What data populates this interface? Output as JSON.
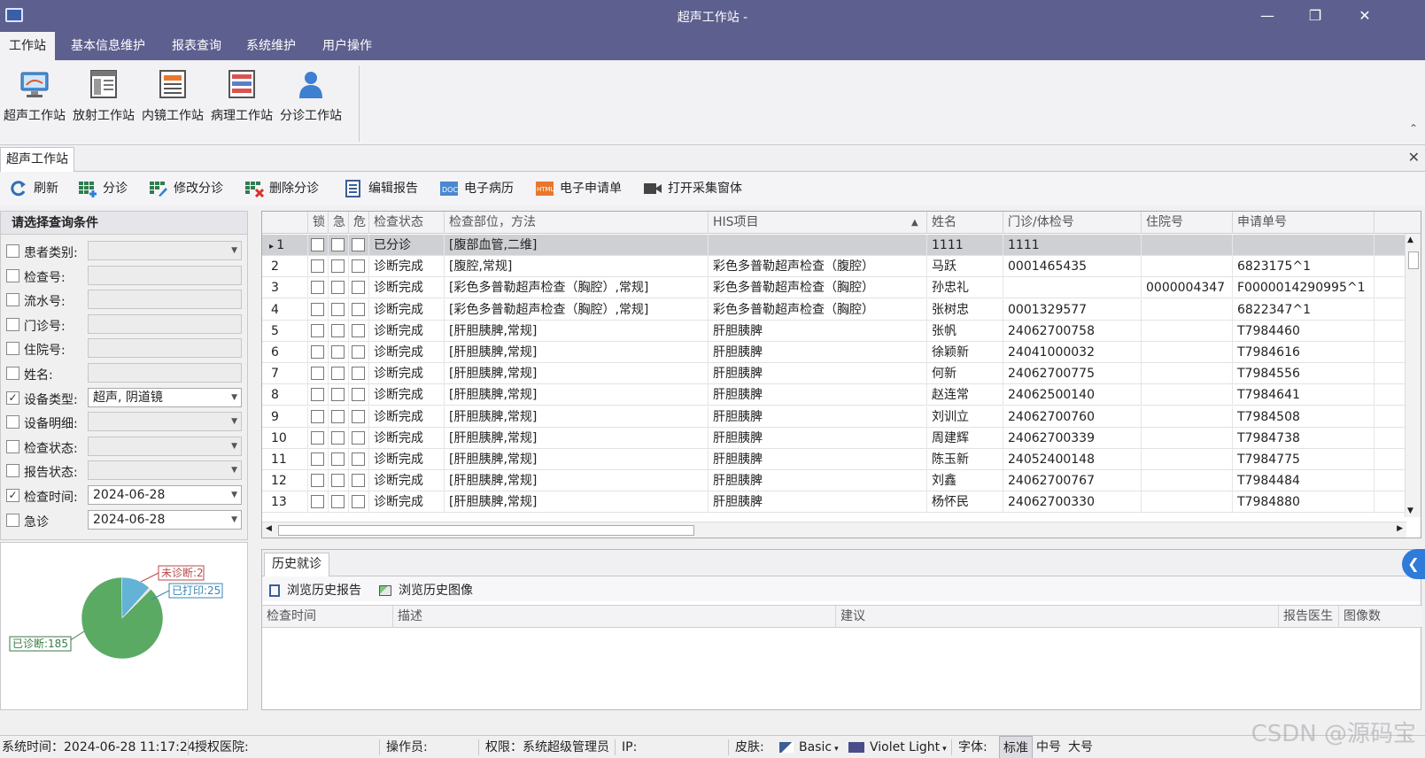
{
  "window": {
    "title": "超声工作站 -",
    "controls": [
      "—",
      "❐",
      "✕"
    ]
  },
  "menu": [
    {
      "label": "工作站",
      "active": true
    },
    {
      "label": "基本信息维护"
    },
    {
      "label": "报表查询"
    },
    {
      "label": "系统维护"
    },
    {
      "label": "用户操作"
    }
  ],
  "ribbon": {
    "buttons": [
      {
        "label": "超声工作站",
        "icon": "ultrasound-monitor-icon"
      },
      {
        "label": "放射工作站",
        "icon": "radiology-panel-icon"
      },
      {
        "label": "内镜工作站",
        "icon": "endoscope-panel-icon"
      },
      {
        "label": "病理工作站",
        "icon": "pathology-panel-icon"
      },
      {
        "label": "分诊工作站",
        "icon": "person-icon"
      }
    ],
    "collapse": "⌃"
  },
  "doc_tab": {
    "label": "超声工作站",
    "close": "✕"
  },
  "toolbar": [
    {
      "label": "刷新",
      "icon": "refresh-icon"
    },
    {
      "label": "分诊",
      "icon": "grid-add-icon"
    },
    {
      "label": "修改分诊",
      "icon": "grid-edit-icon"
    },
    {
      "label": "删除分诊",
      "icon": "grid-delete-icon"
    },
    {
      "label": "编辑报告",
      "icon": "document-icon"
    },
    {
      "label": "电子病历",
      "icon": "doc-file-icon"
    },
    {
      "label": "电子申请单",
      "icon": "html-file-icon"
    },
    {
      "label": "打开采集窗体",
      "icon": "video-camera-icon"
    }
  ],
  "query": {
    "title": "请选择查询条件",
    "fields": [
      {
        "label": "患者类别:",
        "checked": false,
        "value": "",
        "dropdown": true,
        "filled": false
      },
      {
        "label": "检查号:",
        "checked": false,
        "value": "",
        "dropdown": false,
        "filled": false
      },
      {
        "label": "流水号:",
        "checked": false,
        "value": "",
        "dropdown": false,
        "filled": false
      },
      {
        "label": "门诊号:",
        "checked": false,
        "value": "",
        "dropdown": false,
        "filled": false
      },
      {
        "label": "住院号:",
        "checked": false,
        "value": "",
        "dropdown": false,
        "filled": false
      },
      {
        "label": "姓名:",
        "checked": false,
        "value": "",
        "dropdown": false,
        "filled": false
      },
      {
        "label": "设备类型:",
        "checked": true,
        "value": "超声, 阴道镜",
        "dropdown": true,
        "filled": true
      },
      {
        "label": "设备明细:",
        "checked": false,
        "value": "",
        "dropdown": true,
        "filled": false
      },
      {
        "label": "检查状态:",
        "checked": false,
        "value": "",
        "dropdown": true,
        "filled": false
      },
      {
        "label": "报告状态:",
        "checked": false,
        "value": "",
        "dropdown": true,
        "filled": false
      },
      {
        "label": "检查时间:",
        "checked": true,
        "value": "2024-06-28",
        "dropdown": true,
        "filled": true
      },
      {
        "label": "急诊",
        "checked": false,
        "value": "2024-06-28",
        "dropdown": true,
        "filled": true
      }
    ]
  },
  "chart_data": {
    "type": "pie",
    "slices": [
      {
        "label": "已诊断:185",
        "value": 185,
        "color": "#5aaa64"
      },
      {
        "label": "已打印:25",
        "value": 25,
        "color": "#62b3d6"
      },
      {
        "label": "未诊断:2",
        "value": 2,
        "color": "#e8e0dc"
      }
    ],
    "label_colors": {
      "已诊断:185": "#3a7a45",
      "已打印:25": "#3a86b3",
      "未诊断:2": "#b84a4a"
    }
  },
  "grid": {
    "columns": [
      "",
      "锁",
      "急",
      "危",
      "检查状态",
      "检查部位，方法",
      "HIS项目",
      "姓名",
      "门诊/体检号",
      "住院号",
      "申请单号"
    ],
    "sort_indicator": "▲",
    "rows": [
      {
        "no": "1",
        "status": "已分诊",
        "part": "[腹部血管,二维]",
        "his": "",
        "name": "1111",
        "mz": "1111",
        "zy": "",
        "apply": "",
        "selected": true
      },
      {
        "no": "2",
        "status": "诊断完成",
        "part": "[腹腔,常规]",
        "his": "彩色多普勒超声检查（腹腔）",
        "name": "马跃",
        "mz": "0001465435",
        "zy": "",
        "apply": "6823175^1"
      },
      {
        "no": "3",
        "status": "诊断完成",
        "part": "[彩色多普勒超声检查（胸腔）,常规]",
        "his": "彩色多普勒超声检查（胸腔）",
        "name": "孙忠礼",
        "mz": "",
        "zy": "0000004347",
        "apply": "F0000014290995^1"
      },
      {
        "no": "4",
        "status": "诊断完成",
        "part": "[彩色多普勒超声检查（胸腔）,常规]",
        "his": "彩色多普勒超声检查（胸腔）",
        "name": "张树忠",
        "mz": "0001329577",
        "zy": "",
        "apply": "6822347^1"
      },
      {
        "no": "5",
        "status": "诊断完成",
        "part": "[肝胆胰脾,常规]",
        "his": "肝胆胰脾",
        "name": "张帆",
        "mz": "24062700758",
        "zy": "",
        "apply": "T7984460"
      },
      {
        "no": "6",
        "status": "诊断完成",
        "part": "[肝胆胰脾,常规]",
        "his": "肝胆胰脾",
        "name": "徐颖新",
        "mz": "24041000032",
        "zy": "",
        "apply": "T7984616"
      },
      {
        "no": "7",
        "status": "诊断完成",
        "part": "[肝胆胰脾,常规]",
        "his": "肝胆胰脾",
        "name": "何新",
        "mz": "24062700775",
        "zy": "",
        "apply": "T7984556"
      },
      {
        "no": "8",
        "status": "诊断完成",
        "part": "[肝胆胰脾,常规]",
        "his": "肝胆胰脾",
        "name": "赵连常",
        "mz": "24062500140",
        "zy": "",
        "apply": "T7984641"
      },
      {
        "no": "9",
        "status": "诊断完成",
        "part": "[肝胆胰脾,常规]",
        "his": "肝胆胰脾",
        "name": "刘训立",
        "mz": "24062700760",
        "zy": "",
        "apply": "T7984508"
      },
      {
        "no": "10",
        "status": "诊断完成",
        "part": "[肝胆胰脾,常规]",
        "his": "肝胆胰脾",
        "name": "周建辉",
        "mz": "24062700339",
        "zy": "",
        "apply": "T7984738"
      },
      {
        "no": "11",
        "status": "诊断完成",
        "part": "[肝胆胰脾,常规]",
        "his": "肝胆胰脾",
        "name": "陈玉新",
        "mz": "24052400148",
        "zy": "",
        "apply": "T7984775"
      },
      {
        "no": "12",
        "status": "诊断完成",
        "part": "[肝胆胰脾,常规]",
        "his": "肝胆胰脾",
        "name": "刘鑫",
        "mz": "24062700767",
        "zy": "",
        "apply": "T7984484"
      },
      {
        "no": "13",
        "status": "诊断完成",
        "part": "[肝胆胰脾,常规]",
        "his": "肝胆胰脾",
        "name": "杨怀民",
        "mz": "24062700330",
        "zy": "",
        "apply": "T7984880"
      }
    ]
  },
  "history": {
    "tab": "历史就诊",
    "tools": [
      {
        "label": "浏览历史报告",
        "icon": "report-icon"
      },
      {
        "label": "浏览历史图像",
        "icon": "image-icon"
      }
    ],
    "columns": [
      "检查时间",
      "描述",
      "建议",
      "报告医生",
      "图像数"
    ]
  },
  "status": {
    "time": "系统时间：2024-06-28 11:17:24",
    "hospital": "授权医院:",
    "operator": "操作员:",
    "permission": "权限：系统超级管理员",
    "ip": "IP:",
    "skin_label": "皮肤:",
    "skin_basic": "Basic",
    "skin_theme": "Violet Light",
    "font_label": "字体:",
    "font_options": [
      "标准",
      "中号",
      "大号"
    ]
  },
  "watermark": "CSDN @源码宝"
}
